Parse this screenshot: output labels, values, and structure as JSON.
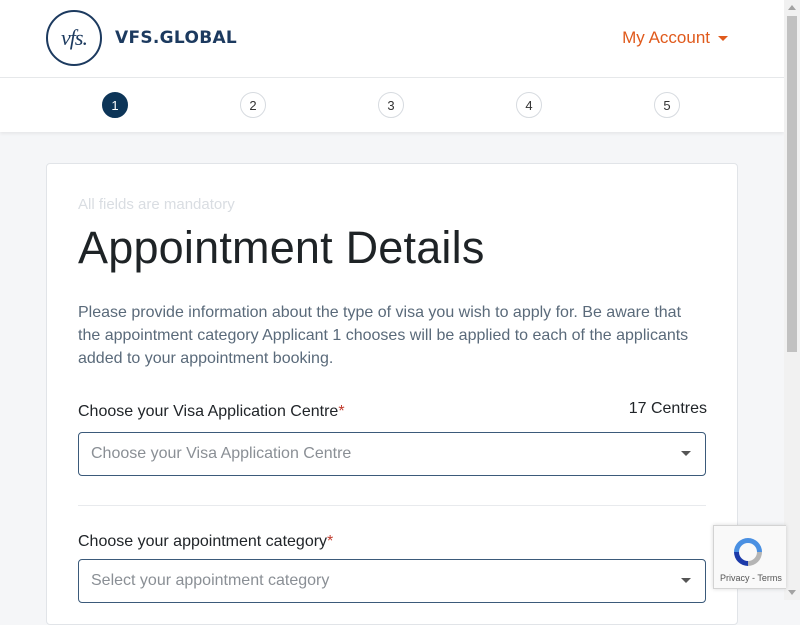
{
  "header": {
    "logo_mark": "vfs.",
    "logo_text": "VFS.GLOBAL",
    "account_label": "My Account"
  },
  "stepper": {
    "steps": [
      "1",
      "2",
      "3",
      "4",
      "5"
    ],
    "active_step": "1"
  },
  "form": {
    "mandatory_note": "All fields are mandatory",
    "title": "Appointment Details",
    "intro": "Please provide information about the type of visa you wish to apply for. Be aware that the appointment category Applicant 1 chooses will be applied to each of the applicants added to your appointment booking.",
    "centre_label": "Choose your Visa Application Centre",
    "required_mark": "*",
    "centre_count": "17 Centres",
    "centre_placeholder": "Choose your Visa Application Centre",
    "category_label": "Choose your appointment category",
    "category_placeholder": "Select your appointment category"
  },
  "recaptcha": {
    "footer": "Privacy - Terms"
  },
  "colors": {
    "brand_navy": "#0d3558",
    "account_orange": "#e05a1c",
    "required_red": "#c0392b"
  }
}
